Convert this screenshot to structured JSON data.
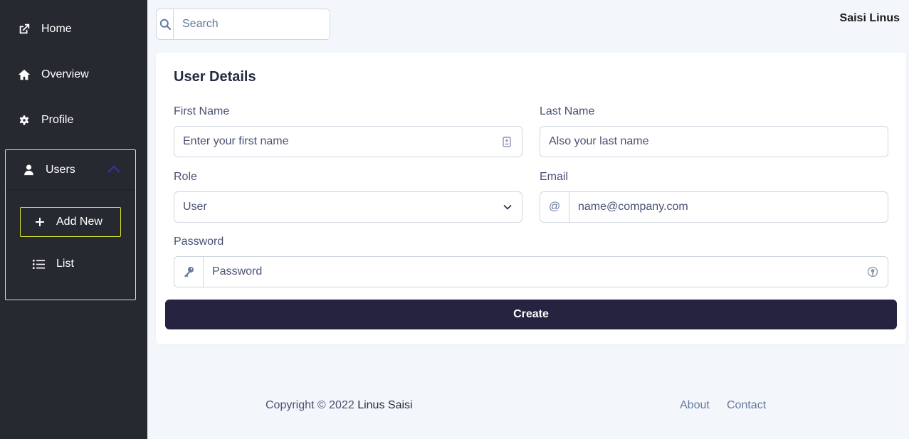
{
  "sidebar": {
    "items": [
      {
        "label": "Home",
        "icon": "external-link-icon"
      },
      {
        "label": "Overview",
        "icon": "house-icon"
      },
      {
        "label": "Profile",
        "icon": "gear-icon"
      }
    ],
    "users": {
      "label": "Users",
      "icon": "user-icon",
      "expanded": true,
      "children": [
        {
          "label": "Add New",
          "icon": "plus-icon"
        },
        {
          "label": "List",
          "icon": "list-icon"
        }
      ]
    }
  },
  "topbar": {
    "search_placeholder": "Search",
    "user_name": "Saisi Linus"
  },
  "form": {
    "title": "User Details",
    "first_name": {
      "label": "First Name",
      "placeholder": "Enter your first name"
    },
    "last_name": {
      "label": "Last Name",
      "placeholder": "Also your last name"
    },
    "role": {
      "label": "Role",
      "value": "User"
    },
    "email": {
      "label": "Email",
      "addon": "@",
      "placeholder": "name@company.com"
    },
    "password": {
      "label": "Password",
      "placeholder": "Password"
    },
    "submit_label": "Create"
  },
  "footer": {
    "copyright": "Copyright © 2022",
    "author": "Linus Saisi",
    "links": [
      "About",
      "Contact"
    ]
  },
  "colors": {
    "sidebar_bg": "#262a30",
    "page_bg": "#f3f6fa",
    "primary_button": "#262340",
    "add_new_border": "#d8e42c",
    "chevron_accent": "#3b2fb8"
  }
}
